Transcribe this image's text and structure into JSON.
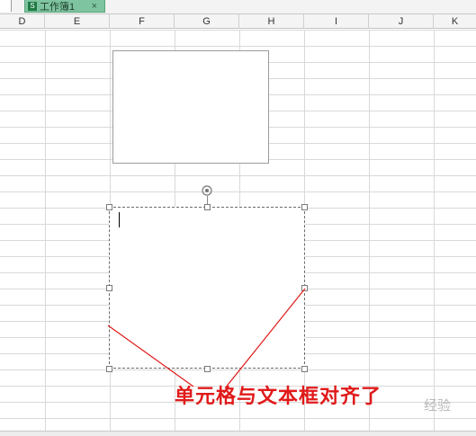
{
  "tab": {
    "icon": "S",
    "label": "工作簿1",
    "close": "×"
  },
  "columns": [
    "D",
    "E",
    "F",
    "G",
    "H",
    "I",
    "J",
    "K"
  ],
  "annotation": "单元格与文本框对齐了",
  "watermark": "经验",
  "colors": {
    "tab_bg": "#7fc4a0",
    "annotation": "#e01a1a",
    "grid": "#d9d9d9"
  },
  "icons": {
    "rotate": "rotate-handle-icon"
  }
}
